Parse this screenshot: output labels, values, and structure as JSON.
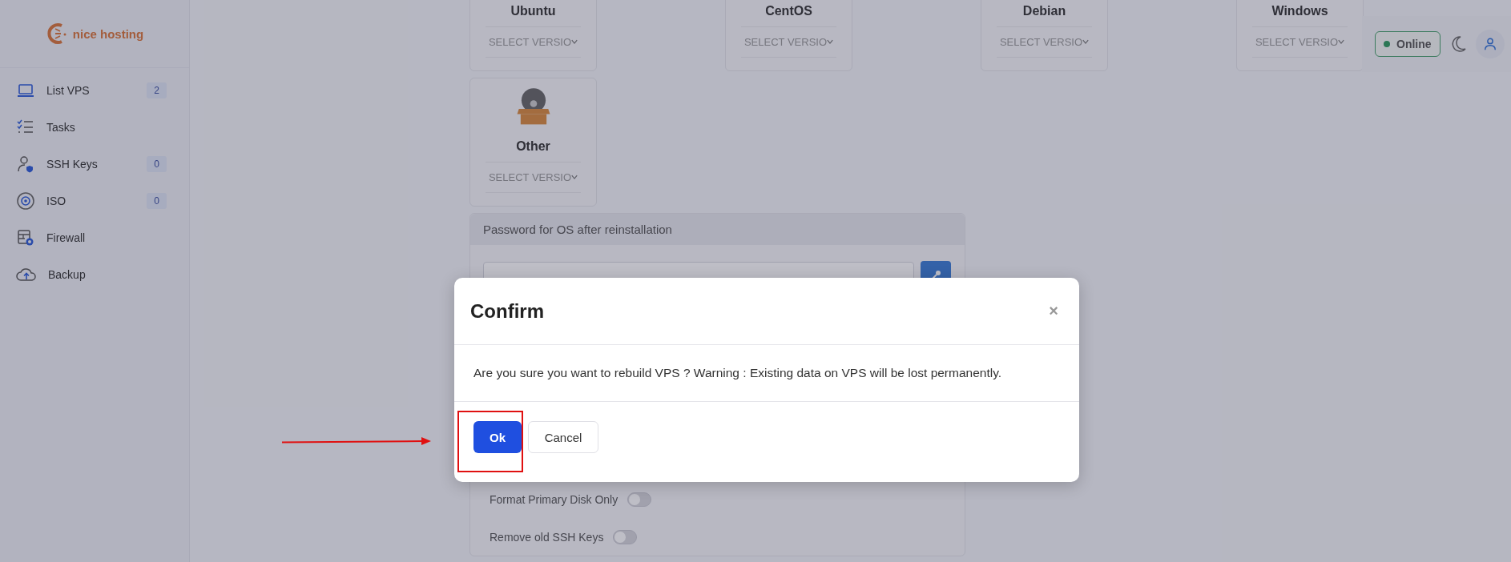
{
  "sidebar": {
    "logo": "nice hosting",
    "items": [
      {
        "label": "List VPS",
        "badge": "2"
      },
      {
        "label": "Tasks"
      },
      {
        "label": "SSH Keys",
        "badge": "0"
      },
      {
        "label": "ISO",
        "badge": "0"
      },
      {
        "label": "Firewall"
      },
      {
        "label": "Backup"
      }
    ]
  },
  "os_options": [
    {
      "name": "Ubuntu",
      "select": "SELECT VERSIO",
      "kind": "cut"
    },
    {
      "name": "CentOS",
      "select": "SELECT VERSIO",
      "kind": "cut"
    },
    {
      "name": "Debian",
      "select": "SELECT VERSIO",
      "kind": "cut"
    },
    {
      "name": "Windows",
      "select": "SELECT VERSIO",
      "kind": "cut"
    },
    {
      "name": "Other",
      "select": "SELECT VERSIO",
      "kind": "full"
    }
  ],
  "password_panel": {
    "title": "Password for OS after reinstallation"
  },
  "toggles": [
    {
      "label": "Format Primary Disk Only",
      "on": false
    },
    {
      "label": "Remove old SSH Keys",
      "on": false
    }
  ],
  "header": {
    "status": "Online"
  },
  "modal": {
    "title": "Confirm",
    "close": "×",
    "message": "Are you sure you want to rebuild VPS ? Warning : Existing data on VPS will be lost permanently.",
    "buttons": [
      {
        "label": "Ok",
        "kind": "primary"
      },
      {
        "label": "Cancel",
        "kind": "secondary"
      }
    ]
  }
}
